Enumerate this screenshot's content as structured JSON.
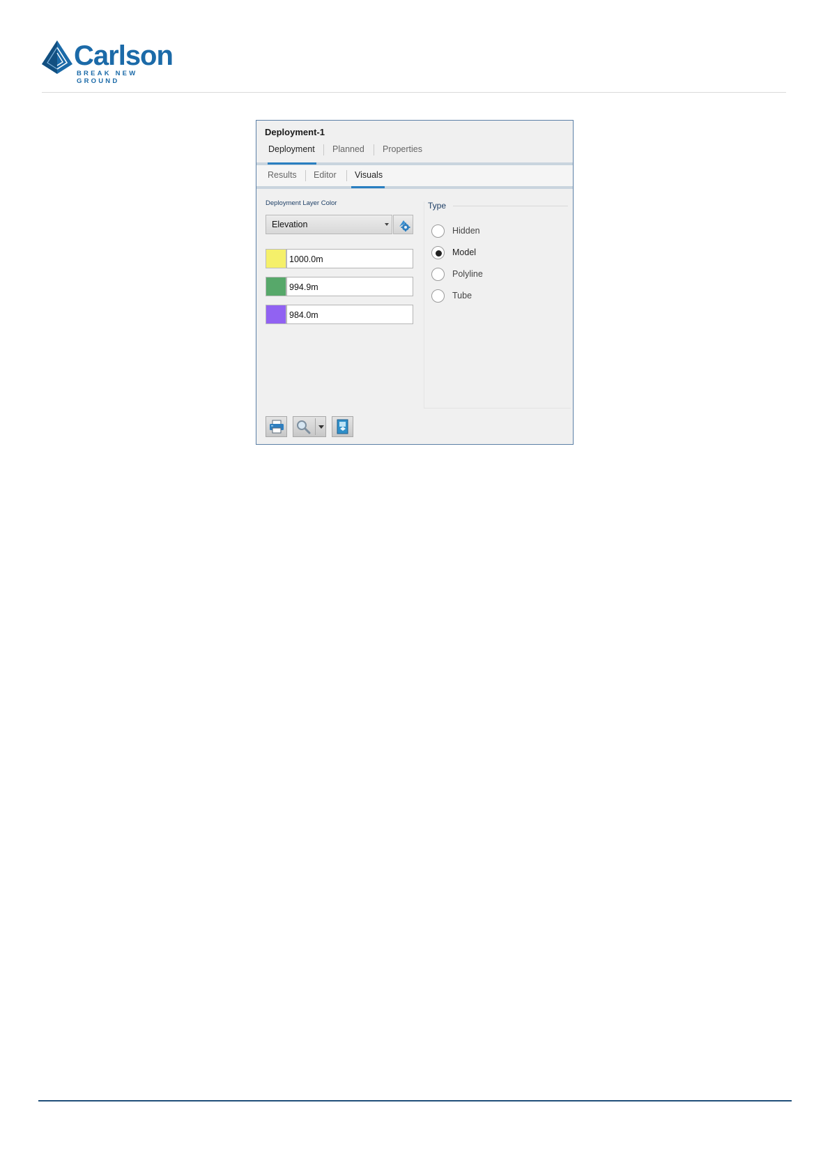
{
  "brand": {
    "name": "Carlson",
    "tagline": "BREAK NEW GROUND",
    "color": "#1b6aa8"
  },
  "panel": {
    "title": "Deployment-1",
    "tabs": [
      {
        "label": "Deployment",
        "active": true
      },
      {
        "label": "Planned",
        "active": false
      },
      {
        "label": "Properties",
        "active": false
      }
    ],
    "subtabs": [
      {
        "label": "Results",
        "active": false
      },
      {
        "label": "Editor",
        "active": false
      },
      {
        "label": "Visuals",
        "active": true
      }
    ],
    "layer_color": {
      "label": "Deployment Layer Color",
      "selected": "Elevation",
      "settings_icon": "palette-settings-icon"
    },
    "elevation_stops": [
      {
        "color": "#f5f06a",
        "value": "1000.0m"
      },
      {
        "color": "#57a86a",
        "value": "994.9m"
      },
      {
        "color": "#9162f2",
        "value": "984.0m"
      }
    ],
    "type": {
      "label": "Type",
      "options": [
        {
          "label": "Hidden",
          "selected": false
        },
        {
          "label": "Model",
          "selected": true
        },
        {
          "label": "Polyline",
          "selected": false
        },
        {
          "label": "Tube",
          "selected": false
        }
      ]
    },
    "toolbar": {
      "print_icon": "printer-icon",
      "zoom_icon": "zoom-icon",
      "export_icon": "export-icon"
    }
  }
}
